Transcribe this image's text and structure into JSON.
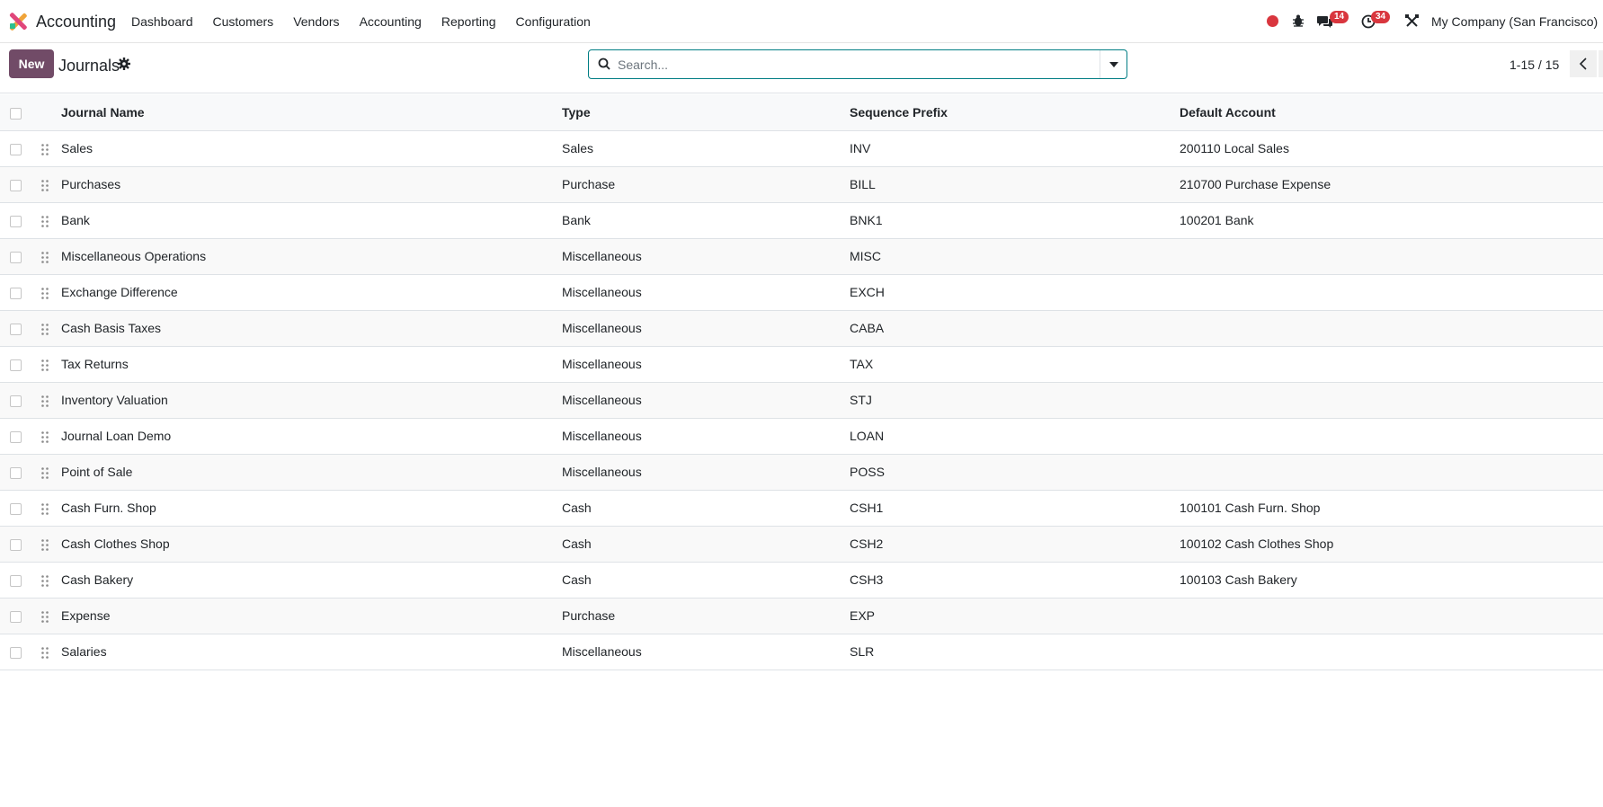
{
  "app": {
    "name": "Accounting"
  },
  "menu": [
    "Dashboard",
    "Customers",
    "Vendors",
    "Accounting",
    "Reporting",
    "Configuration"
  ],
  "nav": {
    "messages_count": "14",
    "activities_count": "34",
    "company": "My Company (San Francisco)"
  },
  "control": {
    "new_label": "New",
    "title": "Journals",
    "search_placeholder": "Search...",
    "pager": "1-15 / 15"
  },
  "table": {
    "headers": [
      "Journal Name",
      "Type",
      "Sequence Prefix",
      "Default Account"
    ],
    "rows": [
      [
        "Sales",
        "Sales",
        "INV",
        "200110 Local Sales"
      ],
      [
        "Purchases",
        "Purchase",
        "BILL",
        "210700 Purchase Expense"
      ],
      [
        "Bank",
        "Bank",
        "BNK1",
        "100201 Bank"
      ],
      [
        "Miscellaneous Operations",
        "Miscellaneous",
        "MISC",
        ""
      ],
      [
        "Exchange Difference",
        "Miscellaneous",
        "EXCH",
        ""
      ],
      [
        "Cash Basis Taxes",
        "Miscellaneous",
        "CABA",
        ""
      ],
      [
        "Tax Returns",
        "Miscellaneous",
        "TAX",
        ""
      ],
      [
        "Inventory Valuation",
        "Miscellaneous",
        "STJ",
        ""
      ],
      [
        "Journal Loan Demo",
        "Miscellaneous",
        "LOAN",
        ""
      ],
      [
        "Point of Sale",
        "Miscellaneous",
        "POSS",
        ""
      ],
      [
        "Cash Furn. Shop",
        "Cash",
        "CSH1",
        "100101 Cash Furn. Shop"
      ],
      [
        "Cash Clothes Shop",
        "Cash",
        "CSH2",
        "100102 Cash Clothes Shop"
      ],
      [
        "Cash Bakery",
        "Cash",
        "CSH3",
        "100103 Cash Bakery"
      ],
      [
        "Expense",
        "Purchase",
        "EXP",
        ""
      ],
      [
        "Salaries",
        "Miscellaneous",
        "SLR",
        ""
      ]
    ]
  },
  "colors": {
    "brand": "#714b67",
    "accent": "#017e84",
    "badge": "#d9363e"
  },
  "icons": [
    "app-logo-icon",
    "record-icon",
    "bug-icon",
    "chat-icon",
    "clock-icon",
    "tools-icon",
    "gear-icon",
    "search-icon",
    "caret-down-icon",
    "chevron-left-icon",
    "drag-handle-icon"
  ]
}
